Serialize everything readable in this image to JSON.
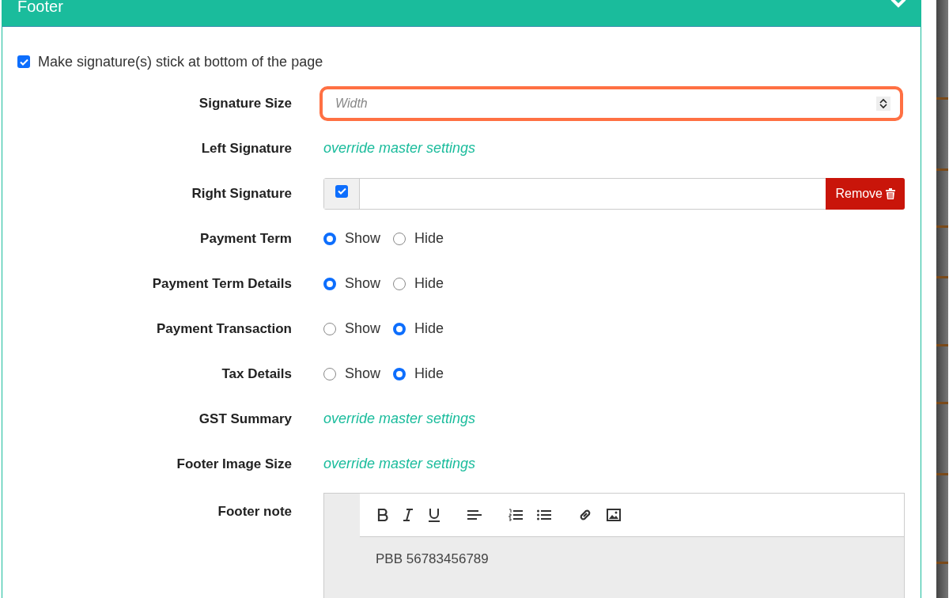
{
  "panel": {
    "title": "Footer",
    "expanded": true
  },
  "stick_checkbox": {
    "label": "Make signature(s) stick at bottom of the page",
    "checked": true
  },
  "rows": [
    {
      "label": "Signature Size",
      "kind": "number",
      "placeholder": "Width",
      "highlighted": true
    },
    {
      "label": "Left Signature",
      "kind": "link",
      "link": "override master settings"
    },
    {
      "label": "Right Signature",
      "kind": "file",
      "checked": true,
      "button": "Remove"
    },
    {
      "label": "Payment Term",
      "kind": "radio",
      "options": [
        {
          "label": "Show",
          "selected": true
        },
        {
          "label": "Hide",
          "selected": false
        }
      ]
    },
    {
      "label": "Payment Term Details",
      "kind": "radio",
      "options": [
        {
          "label": "Show",
          "selected": true
        },
        {
          "label": "Hide",
          "selected": false
        }
      ]
    },
    {
      "label": "Payment Transaction",
      "kind": "radio",
      "options": [
        {
          "label": "Show",
          "selected": false
        },
        {
          "label": "Hide",
          "selected": true
        }
      ]
    },
    {
      "label": "Tax Details",
      "kind": "radio",
      "options": [
        {
          "label": "Show",
          "selected": false
        },
        {
          "label": "Hide",
          "selected": true
        }
      ]
    },
    {
      "label": "GST Summary",
      "kind": "link",
      "link": "override master settings"
    },
    {
      "label": "Footer Image Size",
      "kind": "link",
      "link": "override master settings"
    },
    {
      "label": "Footer note",
      "kind": "editor",
      "content": "PBB 56783456789"
    }
  ]
}
